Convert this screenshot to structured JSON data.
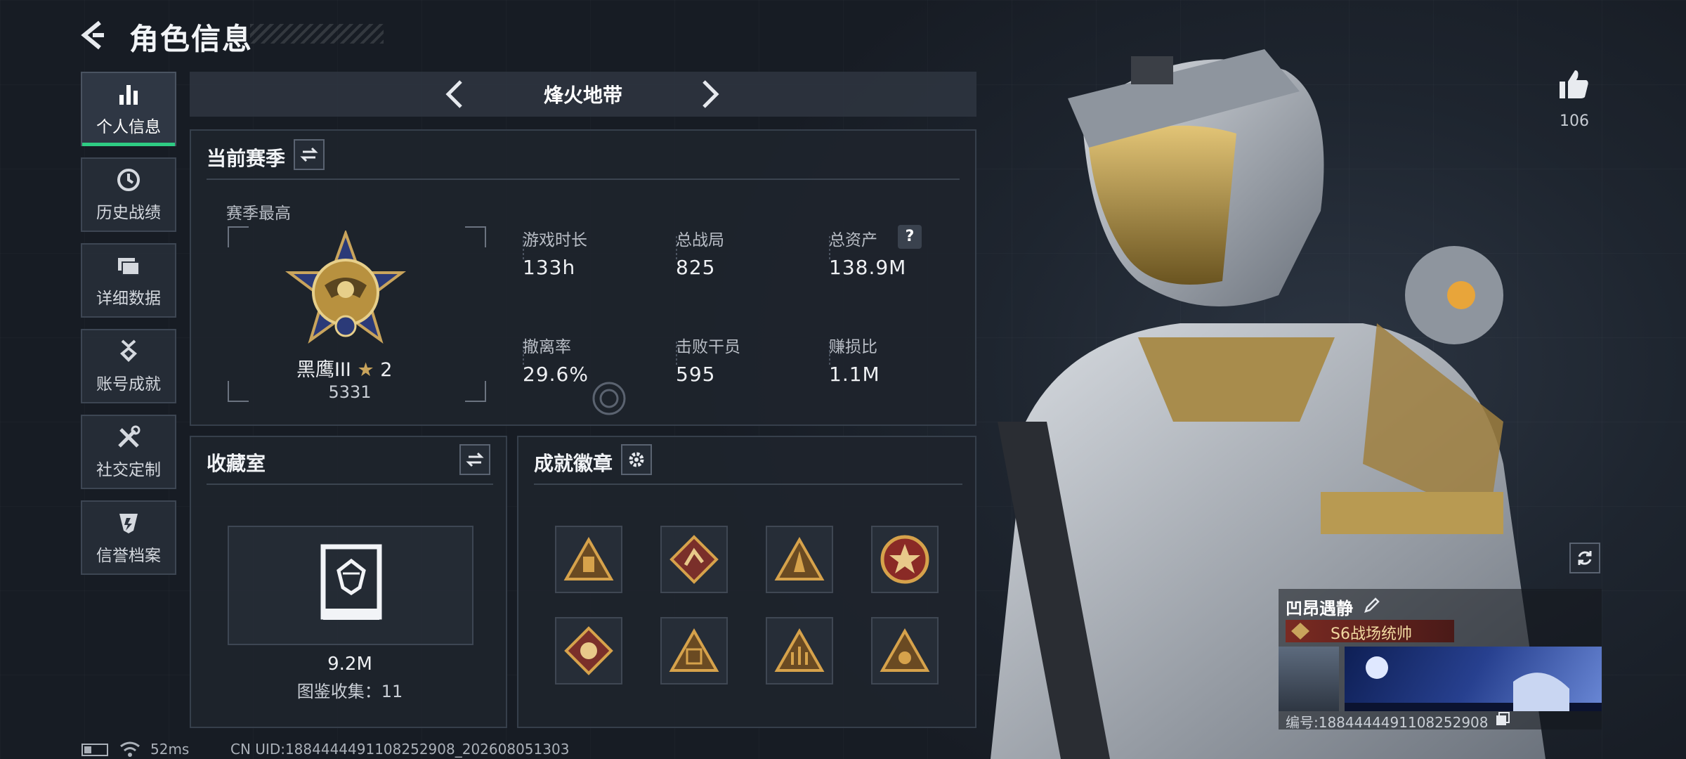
{
  "header": {
    "title": "角色信息"
  },
  "sidebar": {
    "items": [
      {
        "label": "个人信息",
        "icon": "bar-chart-icon",
        "active": true
      },
      {
        "label": "历史战绩",
        "icon": "clock-icon"
      },
      {
        "label": "详细数据",
        "icon": "folders-icon"
      },
      {
        "label": "账号成就",
        "icon": "medal-icon"
      },
      {
        "label": "社交定制",
        "icon": "tools-icon"
      },
      {
        "label": "信誉档案",
        "icon": "shield-icon"
      }
    ]
  },
  "mode_selector": {
    "current": "烽火地带"
  },
  "season": {
    "title": "当前赛季",
    "best_label": "赛季最高",
    "rank_name": "黑鹰III",
    "rank_stars": "2",
    "rank_points": "5331",
    "stats": [
      {
        "label": "游戏时长",
        "value": "133h"
      },
      {
        "label": "总战局",
        "value": "825"
      },
      {
        "label": "总资产",
        "value": "138.9M",
        "help": "?"
      },
      {
        "label": "撤离率",
        "value": "29.6%"
      },
      {
        "label": "击败干员",
        "value": "595"
      },
      {
        "label": "赚损比",
        "value": "1.1M"
      }
    ]
  },
  "collection": {
    "title": "收藏室",
    "value": "9.2M",
    "count_label": "图鉴收集：11"
  },
  "achievements": {
    "title": "成就徽章",
    "badge_count": 8
  },
  "player": {
    "likes": "106",
    "name": "凹昂遇静",
    "title_tag": "S6战场统帅",
    "id_label": "编号:1884444491108252908"
  },
  "status_bar": {
    "ping": "52ms",
    "uid": "CN UID:1884444491108252908_202608051303"
  },
  "colors": {
    "accent": "#2ecc83",
    "gold": "#c9a45c",
    "panel": "#1e242d"
  }
}
